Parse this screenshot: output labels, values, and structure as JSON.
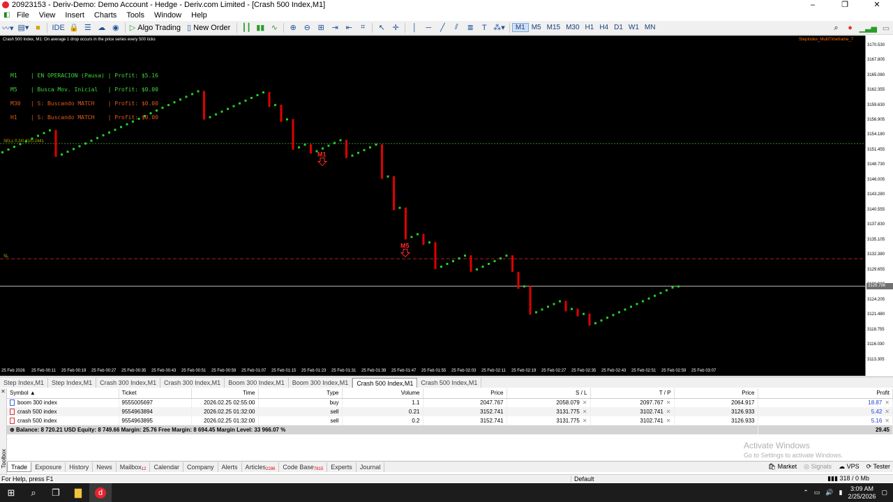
{
  "window": {
    "title": "20923153 - Deriv-Demo: Demo Account - Hedge - Deriv.com Limited - [Crash 500 Index,M1]",
    "controls": [
      "–",
      "❐",
      "✕"
    ]
  },
  "menu": [
    "File",
    "View",
    "Insert",
    "Charts",
    "Tools",
    "Window",
    "Help"
  ],
  "toolbar": {
    "ide_label": "IDE",
    "algo_trading_label": "Algo Trading",
    "new_order_label": "New Order",
    "timeframes": [
      "M1",
      "M5",
      "M15",
      "M30",
      "H1",
      "H4",
      "D1",
      "W1",
      "MN"
    ],
    "active_timeframe": "M1"
  },
  "chart": {
    "header": "Crash 500 Index, M1:  On average 1 drop occurs in the price series every 500 ticks",
    "indicator_label": "StepIndex_MultiTimeframe_7",
    "sell_line_label": "SELL 0.2/0.21/0.2441",
    "sl_label": "SL",
    "panel": [
      {
        "text": "M1    | EN OPERACION (Pausa) | Profit: $5.16",
        "color": "#3ed63e"
      },
      {
        "text": "M5    | Busca Mov. Inicial   | Profit: $0.00",
        "color": "#3ed63e"
      },
      {
        "text": "M30   | S: Buscando MATCH    | Profit: $0.00",
        "color": "#e25a1c"
      },
      {
        "text": "H1    | S: Buscando MATCH    | Profit: $0.00",
        "color": "#e25a1c"
      }
    ],
    "markers": [
      {
        "label": "M1",
        "time_index": 54
      },
      {
        "label": "M5",
        "time_index": 68
      }
    ],
    "price_ticks": [
      "3170.530",
      "3167.805",
      "3165.080",
      "3162.355",
      "3159.630",
      "3156.905",
      "3154.180",
      "3151.455",
      "3148.730",
      "3146.005",
      "3143.280",
      "3140.555",
      "3137.830",
      "3135.105",
      "3132.380",
      "3129.655",
      "3126.930",
      "3124.205",
      "3121.480",
      "3118.755",
      "3116.030",
      "3113.305"
    ],
    "current_price": "3126.796",
    "time_ticks": [
      "25 Feb 2026",
      "25 Feb 00:11",
      "25 Feb 00:19",
      "25 Feb 00:27",
      "25 Feb 00:35",
      "25 Feb 00:43",
      "25 Feb 00:51",
      "25 Feb 00:59",
      "25 Feb 01:07",
      "25 Feb 01:15",
      "25 Feb 01:23",
      "25 Feb 01:31",
      "25 Feb 01:39",
      "25 Feb 01:47",
      "25 Feb 01:55",
      "25 Feb 02:03",
      "25 Feb 02:11",
      "25 Feb 02:19",
      "25 Feb 02:27",
      "25 Feb 02:35",
      "25 Feb 02:43",
      "25 Feb 02:51",
      "25 Feb 02:59",
      "25 Feb 03:07"
    ]
  },
  "chart_data": {
    "type": "line",
    "series": [
      {
        "values": [
          3151.2,
          3151.7,
          3152.2,
          3152.7,
          3153.2,
          3153.7,
          3154.2,
          3154.7,
          3155.2,
          3150.3,
          3150.8,
          3151.3,
          3151.8,
          3152.3,
          3152.8,
          3153.3,
          3153.8,
          3154.3,
          3154.8,
          3155.3,
          3155.8,
          3156.3,
          3156.8,
          3157.3,
          3157.8,
          3158.3,
          3158.8,
          3159.3,
          3159.8,
          3160.3,
          3160.8,
          3161.3,
          3161.8,
          3162.3,
          3157.1,
          3157.6,
          3158.1,
          3158.6,
          3159.1,
          3159.6,
          3160.1,
          3160.6,
          3161.1,
          3161.6,
          3162.1,
          3159.4,
          3159.8,
          3156.7,
          3157.2,
          3151.6,
          3152.1,
          3152.6,
          3150.9,
          3151.4,
          3151.9,
          3152.4,
          3152.9,
          3153.4,
          3150.1,
          3150.6,
          3151.1,
          3151.6,
          3152.1,
          3152.6,
          3146.3,
          3146.8,
          3140.6,
          3141.1,
          3135.3,
          3135.8,
          3136.3,
          3134.3,
          3134.8,
          3129.9,
          3130.4,
          3130.9,
          3131.4,
          3131.9,
          3132.4,
          3129.4,
          3129.9,
          3130.4,
          3130.9,
          3131.4,
          3131.9,
          3132.4,
          3129.4,
          3126.3,
          3126.8,
          3121.6,
          3122.1,
          3122.6,
          3123.1,
          3123.6,
          3124.1,
          3122.2,
          3122.7,
          3121.3,
          3121.8,
          3119.6,
          3120.1,
          3120.6,
          3121.1,
          3121.6,
          3122.1,
          3122.6,
          3123.1,
          3123.6,
          3124.1,
          3124.6,
          3125.1,
          3125.6,
          3126.1,
          3126.6,
          3126.8
        ]
      }
    ],
    "ylim": [
      3112.0,
      3172.0
    ],
    "levels": {
      "sell": 3152.74,
      "sl": 3131.78,
      "current": 3126.796
    },
    "grid": false,
    "legend": "none"
  },
  "symbol_tabs": [
    "Step Index,M1",
    "Step Index,M1",
    "Crash 300 Index,M1",
    "Crash 300 Index,M1",
    "Boom 300 Index,M1",
    "Boom 300 Index,M1",
    "Crash 500 Index,M1",
    "Crash 500 Index,M1"
  ],
  "active_symbol_tab": 6,
  "trades": {
    "columns": [
      "Symbol",
      "Ticket",
      "Time",
      "Type",
      "Volume",
      "Price",
      "S / L",
      "T / P",
      "Price",
      "Profit"
    ],
    "rows": [
      {
        "symbol": "boom 300 index",
        "ticket": "9555005697",
        "time": "2026.02.25 02:55:00",
        "type": "buy",
        "volume": "1.1",
        "price": "2047.767",
        "sl": "2058.079",
        "tp": "2097.767",
        "cur": "2064.917",
        "profit": "18.87"
      },
      {
        "symbol": "crash 500 index",
        "ticket": "9554963894",
        "time": "2026.02.25 01:32:00",
        "type": "sell",
        "volume": "0.21",
        "price": "3152.741",
        "sl": "3131.775",
        "tp": "3102.741",
        "cur": "3126.933",
        "profit": "5.42"
      },
      {
        "symbol": "crash 500 index",
        "ticket": "9554963895",
        "time": "2026.02.25 01:32:00",
        "type": "sell",
        "volume": "0.2",
        "price": "3152.741",
        "sl": "3131.775",
        "tp": "3102.741",
        "cur": "3126.933",
        "profit": "5.16"
      }
    ],
    "balance_text": "Balance: 8 720.21 USD  Equity: 8 749.66  Margin: 25.76  Free Margin: 8 694.45  Margin Level: 33 966.07 %",
    "total_profit": "29.45"
  },
  "watermark": {
    "title": "Activate Windows",
    "subtitle": "Go to Settings to activate Windows."
  },
  "toolbox_label": "Toolbox",
  "bottom_tabs": [
    {
      "label": "Trade",
      "badge": ""
    },
    {
      "label": "Exposure",
      "badge": ""
    },
    {
      "label": "History",
      "badge": ""
    },
    {
      "label": "News",
      "badge": ""
    },
    {
      "label": "Mailbox",
      "badge": "12"
    },
    {
      "label": "Calendar",
      "badge": ""
    },
    {
      "label": "Company",
      "badge": ""
    },
    {
      "label": "Alerts",
      "badge": ""
    },
    {
      "label": "Articles",
      "badge": "2286"
    },
    {
      "label": "Code Base",
      "badge": "7815"
    },
    {
      "label": "Experts",
      "badge": ""
    },
    {
      "label": "Journal",
      "badge": ""
    }
  ],
  "bottom_right": {
    "market": "Market",
    "signals": "Signals",
    "vps": "VPS",
    "tester": "Tester"
  },
  "status": {
    "help": "For Help, press F1",
    "profile": "Default",
    "traffic": "318 / 0 Mb"
  },
  "taskbar": {
    "time": "3:09 AM",
    "date": "2/25/2026"
  },
  "colors": {
    "bull": "#22d422",
    "bear": "#e00000",
    "chart_bg": "#000000",
    "sell_line": "#2f8f2f",
    "sl_line": "#b02020"
  }
}
